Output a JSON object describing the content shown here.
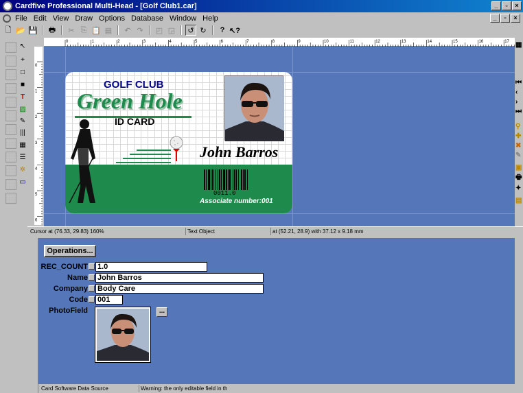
{
  "window": {
    "title": "Cardfive Professional Multi-Head - [Golf Club1.car]"
  },
  "menu": [
    "File",
    "Edit",
    "View",
    "Draw",
    "Options",
    "Database",
    "Window",
    "Help"
  ],
  "ruler": {
    "marks": [
      "0",
      "1",
      "2",
      "3",
      "4",
      "5",
      "6",
      "7",
      "8",
      "9",
      "10",
      "11",
      "12",
      "13",
      "14",
      "15",
      "16",
      "17"
    ],
    "vmarks": [
      "0",
      "1",
      "2",
      "3",
      "4",
      "5",
      "6"
    ]
  },
  "card": {
    "club": "GOLF CLUB",
    "name_logo": "Green Hole",
    "card_type": "ID CARD",
    "holder": "John Barros",
    "barcode_value": "0011.0",
    "associate": "Associate number:001"
  },
  "status": {
    "cursor": "Cursor at (76.33, 29.83) 160%",
    "object": "Text Object",
    "position": "at (52.21, 28.9) with 37.12 x 9.18 mm"
  },
  "panel": {
    "operations_label": "Operations...",
    "fields": [
      {
        "label": "REC_COUNT",
        "value": "1.0"
      },
      {
        "label": "Name",
        "value": "John Barros"
      },
      {
        "label": "Company",
        "value": "Body Care"
      },
      {
        "label": "Code",
        "value": "001"
      }
    ],
    "photo_label": "PhotoField",
    "browse_label": "..."
  },
  "bottom": {
    "source": "Card Software Data Source",
    "warning": "Warning: the only editable field in this"
  },
  "colors": {
    "titlebar": "#000080",
    "workspace": "#5577ba",
    "card_green": "#1e8a4c",
    "logo_green": "#1e8a4c"
  }
}
